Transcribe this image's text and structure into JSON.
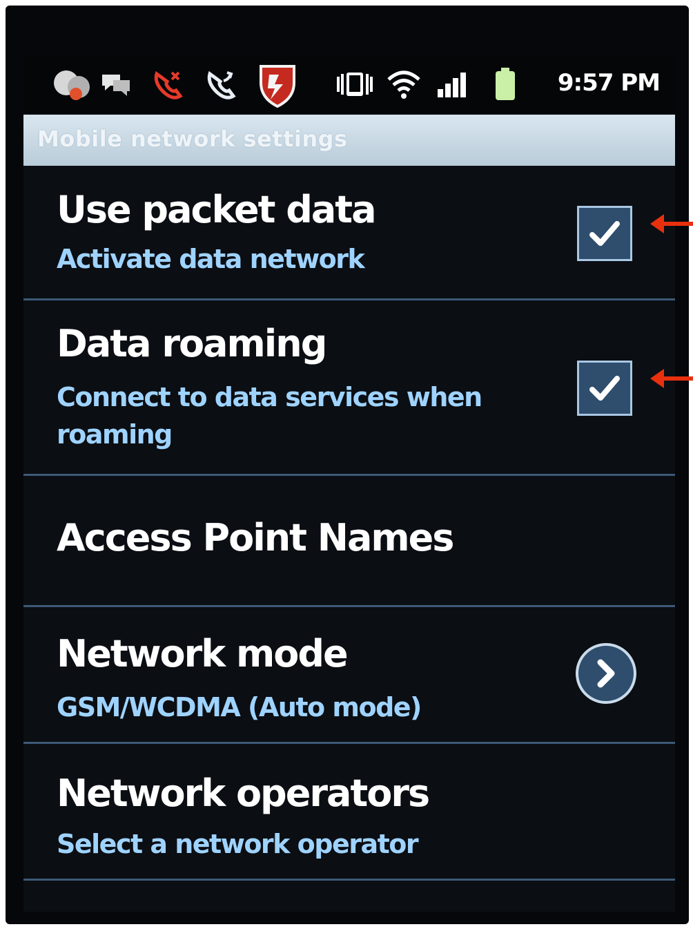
{
  "status_bar": {
    "time": "9:57 PM",
    "icons": [
      "notification-avatar-icon",
      "chat-icon",
      "missed-call-icon",
      "call-forward-icon",
      "security-shield-icon",
      "vibrate-icon",
      "wifi-icon",
      "signal-icon",
      "battery-icon"
    ],
    "battery_level": 1.0
  },
  "title_bar": {
    "title": "Mobile network settings"
  },
  "settings": [
    {
      "title": "Use packet data",
      "summary": "Activate data network",
      "control": "checkbox",
      "checked": true
    },
    {
      "title": "Data roaming",
      "summary": "Connect to data services when roaming",
      "control": "checkbox",
      "checked": true
    },
    {
      "title": "Access Point Names",
      "summary": "",
      "control": "none"
    },
    {
      "title": "Network mode",
      "summary": "GSM/WCDMA (Auto mode)",
      "control": "chevron-right-icon"
    },
    {
      "title": "Network operators",
      "summary": "Select a network operator",
      "control": "none"
    }
  ],
  "colors": {
    "background": "#0b0e13",
    "summary_text": "#9fd3ff",
    "divider": "#3d5a78",
    "checkbox_fill": "#2f4d6c",
    "annotation_arrow": "#e8300f",
    "title_bar": "#c9d9e4"
  }
}
